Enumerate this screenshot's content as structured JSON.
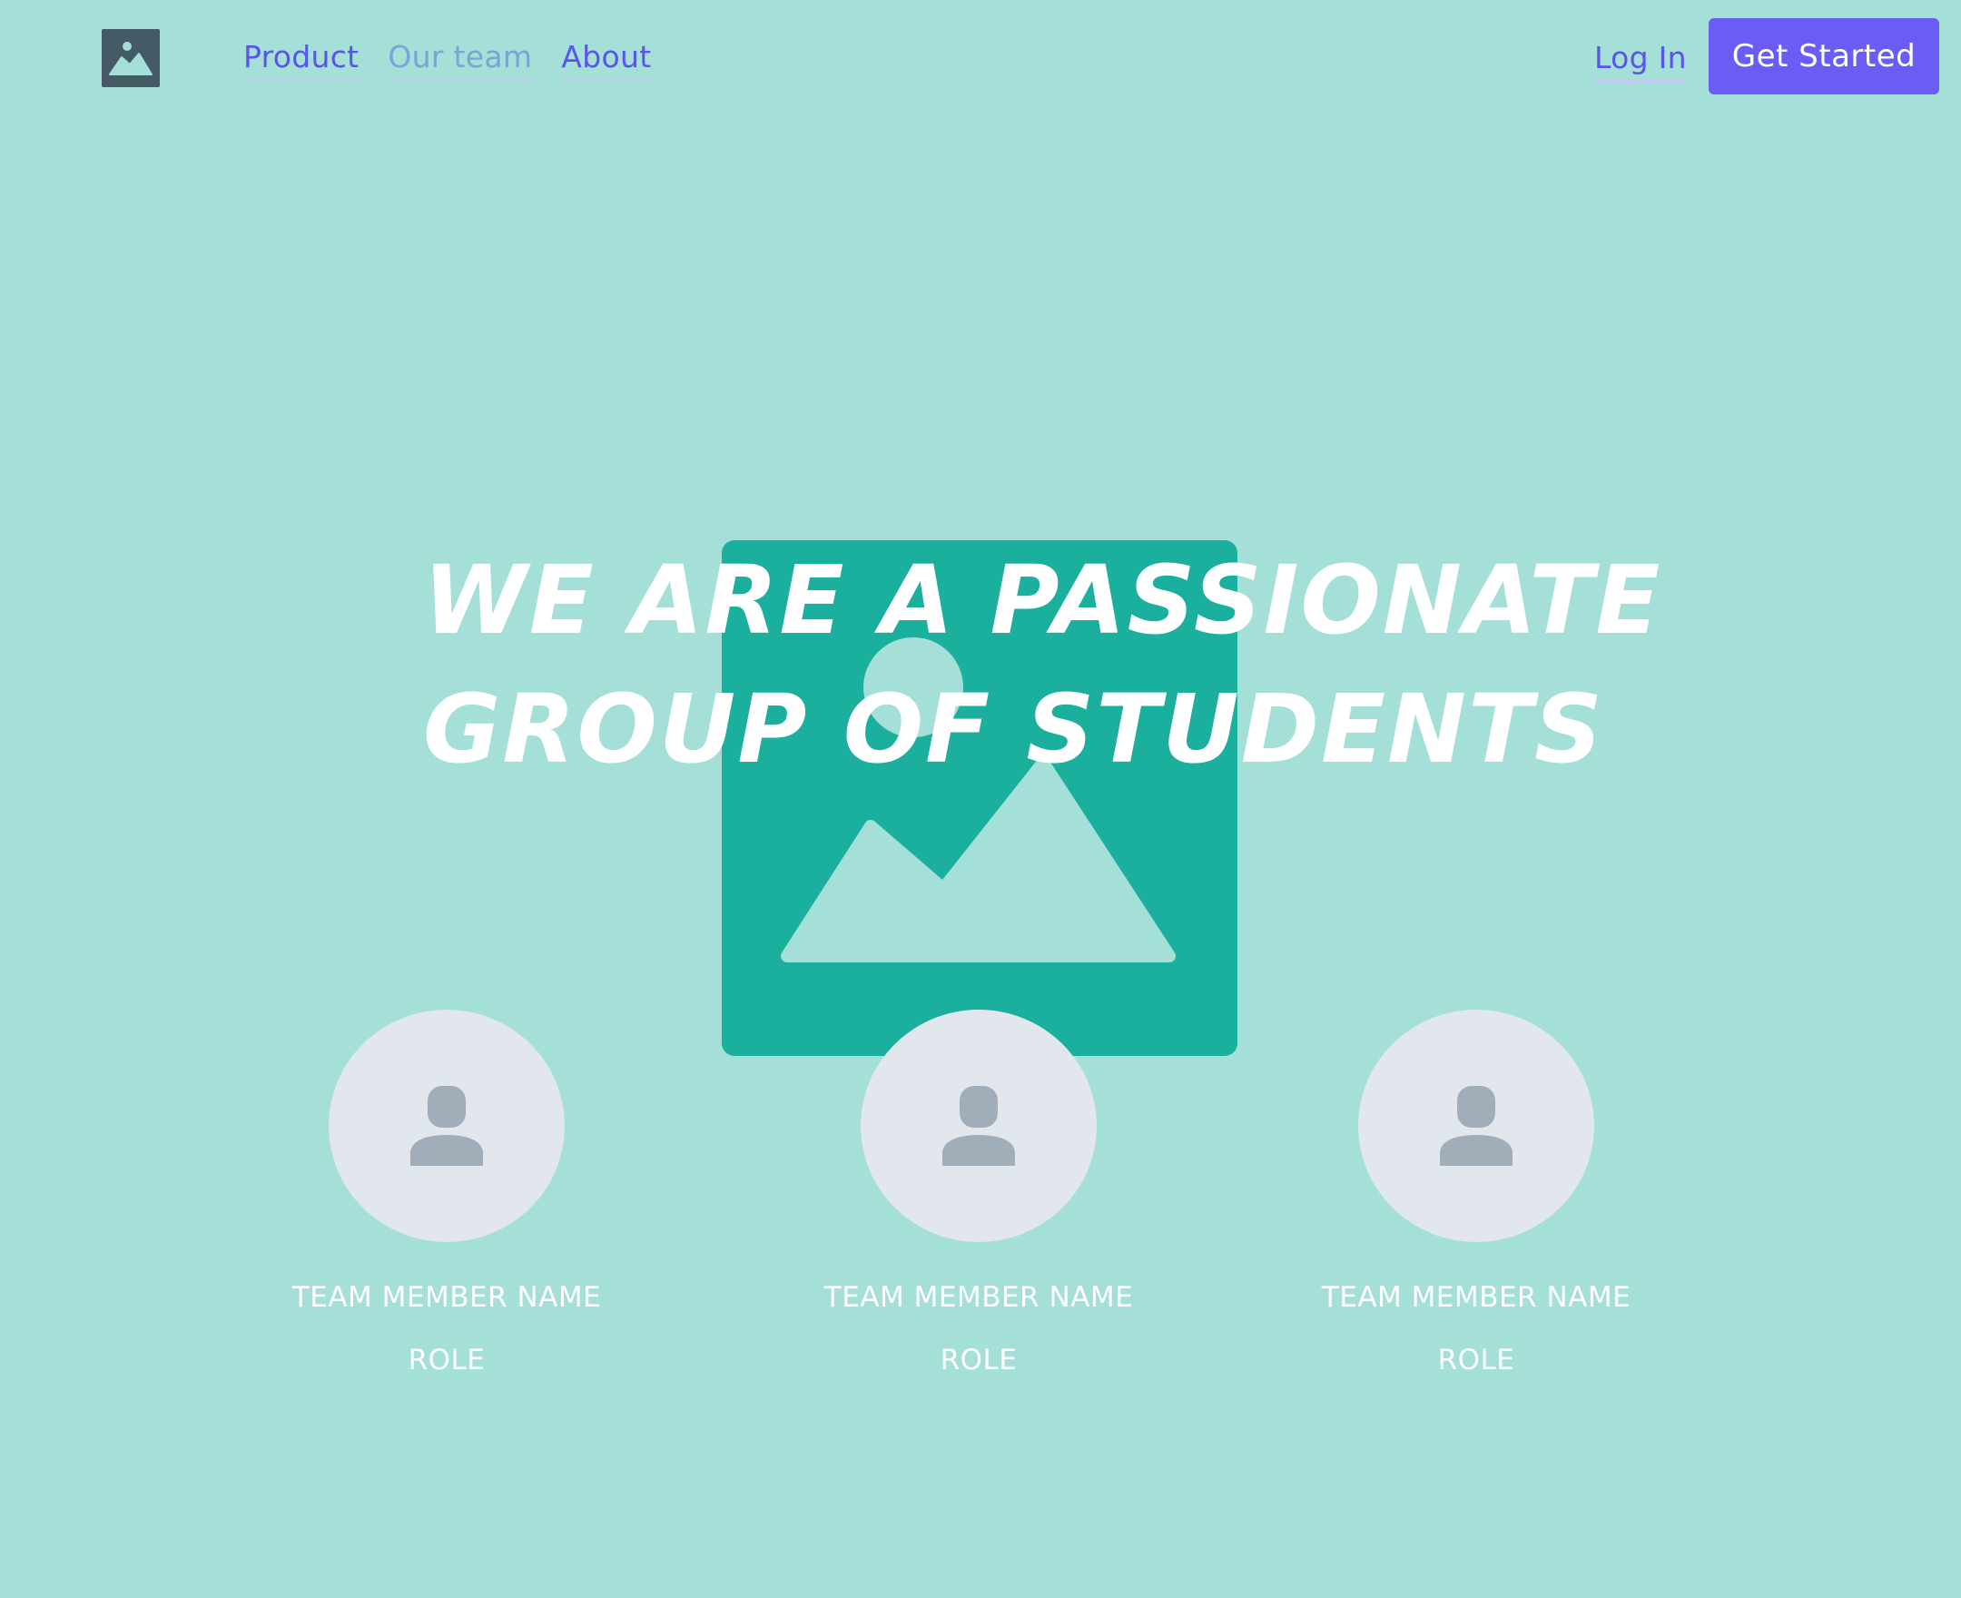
{
  "header": {
    "logo_icon": "image-placeholder-icon",
    "nav": [
      {
        "label": "Product"
      },
      {
        "label": "Our team"
      },
      {
        "label": "About"
      }
    ],
    "login_label": "Log In",
    "cta_label": "Get Started"
  },
  "hero": {
    "headline_line1": "WE ARE A PASSIONATE",
    "headline_line2": "GROUP OF STUDENTS",
    "image_icon": "image-placeholder-icon"
  },
  "team": [
    {
      "name": "TEAM MEMBER NAME",
      "role": "ROLE",
      "avatar_icon": "user-icon"
    },
    {
      "name": "TEAM MEMBER NAME",
      "role": "ROLE",
      "avatar_icon": "user-icon"
    },
    {
      "name": "TEAM MEMBER NAME",
      "role": "ROLE",
      "avatar_icon": "user-icon"
    }
  ],
  "colors": {
    "background": "#a4dfd8",
    "accent": "#6b5cf5",
    "link": "#5a54eb",
    "link_dim": "#7ca3d3",
    "hero_image": "#1baf9e",
    "avatar_bg": "#e1e7ed",
    "avatar_icon": "#a1aeba",
    "logo_bg": "#455a64"
  }
}
